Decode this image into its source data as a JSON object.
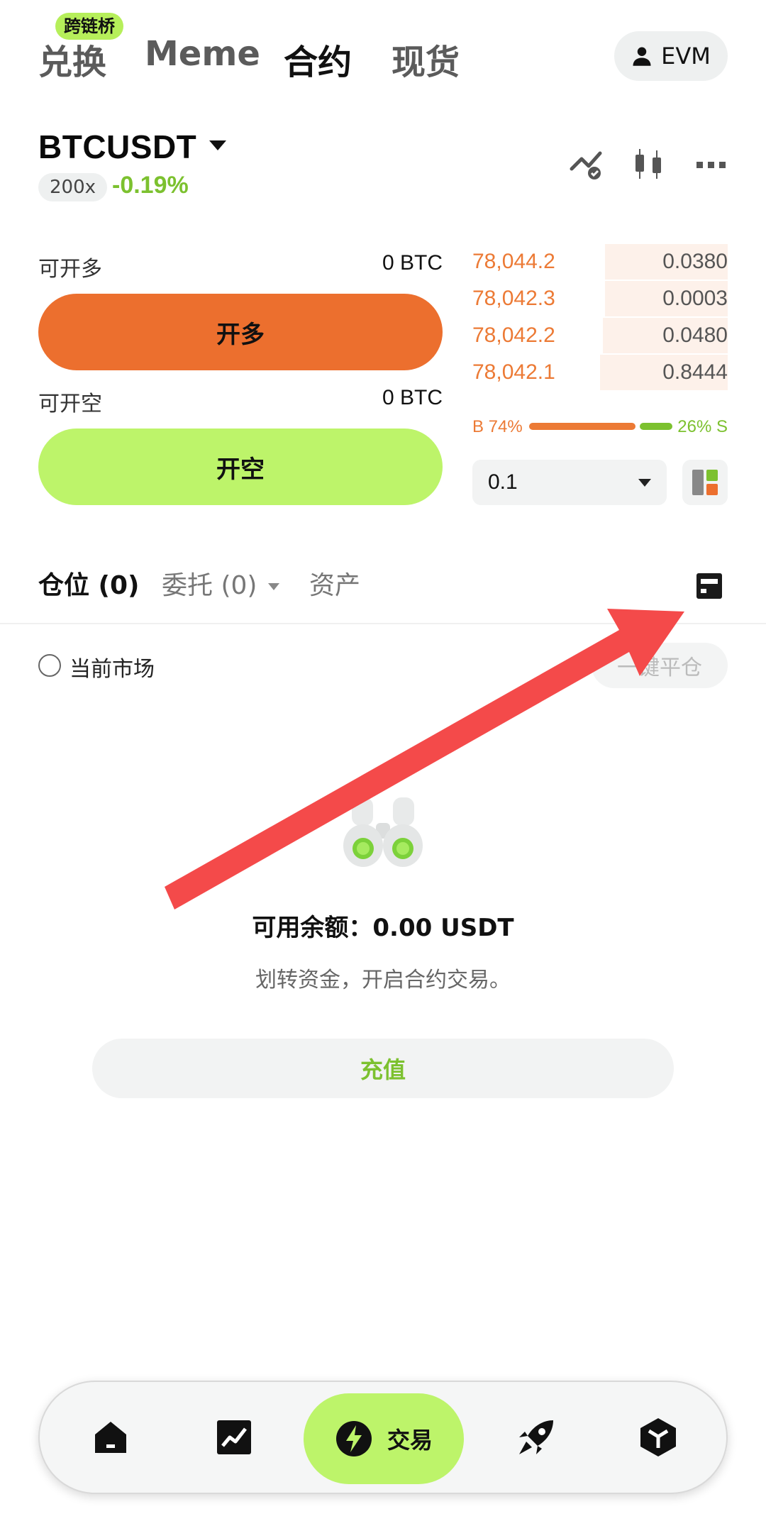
{
  "top_tabs": {
    "bridge_badge": "跨链桥",
    "tabs": [
      {
        "label": "兑换",
        "active": false
      },
      {
        "label": "Meme",
        "active": false
      },
      {
        "label": "合约",
        "active": true
      },
      {
        "label": "现货",
        "active": false
      }
    ],
    "account_button": {
      "icon": "user-icon",
      "label": "EVM"
    }
  },
  "header": {
    "symbol": "BTCUSDT",
    "leverage": "200x",
    "change": "-0.19%",
    "change_color": "#7cc12f",
    "icons": [
      "chart-share-icon",
      "candlestick-icon",
      "more-icon"
    ]
  },
  "trade_panel": {
    "long_available_label": "可开多",
    "long_available_value": "0 BTC",
    "long_button": "开多",
    "short_available_label": "可开空",
    "short_available_value": "0 BTC",
    "short_button": "开空",
    "long_color": "#ec6f2e",
    "short_color": "#bdf46a"
  },
  "orderbook": {
    "rows": [
      {
        "price": "78,044.2",
        "qty": "0.0380",
        "depth": 0.48
      },
      {
        "price": "78,042.3",
        "qty": "0.0003",
        "depth": 0.48
      },
      {
        "price": "78,042.2",
        "qty": "0.0480",
        "depth": 0.49
      },
      {
        "price": "78,042.1",
        "qty": "0.8444",
        "depth": 0.5
      }
    ],
    "buy_ratio": "B 74%",
    "sell_ratio": "26% S",
    "precision": "0.1",
    "layout_icon": "layout-icon"
  },
  "positions": {
    "tabs": [
      {
        "label": "仓位 (0)",
        "active": true
      },
      {
        "label": "委托 (0)",
        "active": false,
        "dropdown": true
      },
      {
        "label": "资产",
        "active": false
      }
    ],
    "collapse_icon": "panel-toggle-icon",
    "current_market_label": "当前市场",
    "close_all_button": "一键平仓",
    "empty_icon": "binoculars-icon",
    "balance_text": "可用余额：0.00 USDT",
    "hint_text": "划转资金，开启合约交易。",
    "deposit_button": "充值"
  },
  "bottom_nav": {
    "items": [
      {
        "icon": "home-icon"
      },
      {
        "icon": "market-chart-icon"
      },
      {
        "icon": "trade-bolt-icon",
        "label": "交易",
        "active": true
      },
      {
        "icon": "rocket-icon"
      },
      {
        "icon": "wallet-cube-icon"
      }
    ]
  },
  "annotation": {
    "arrow_color": "#f44a4a"
  }
}
